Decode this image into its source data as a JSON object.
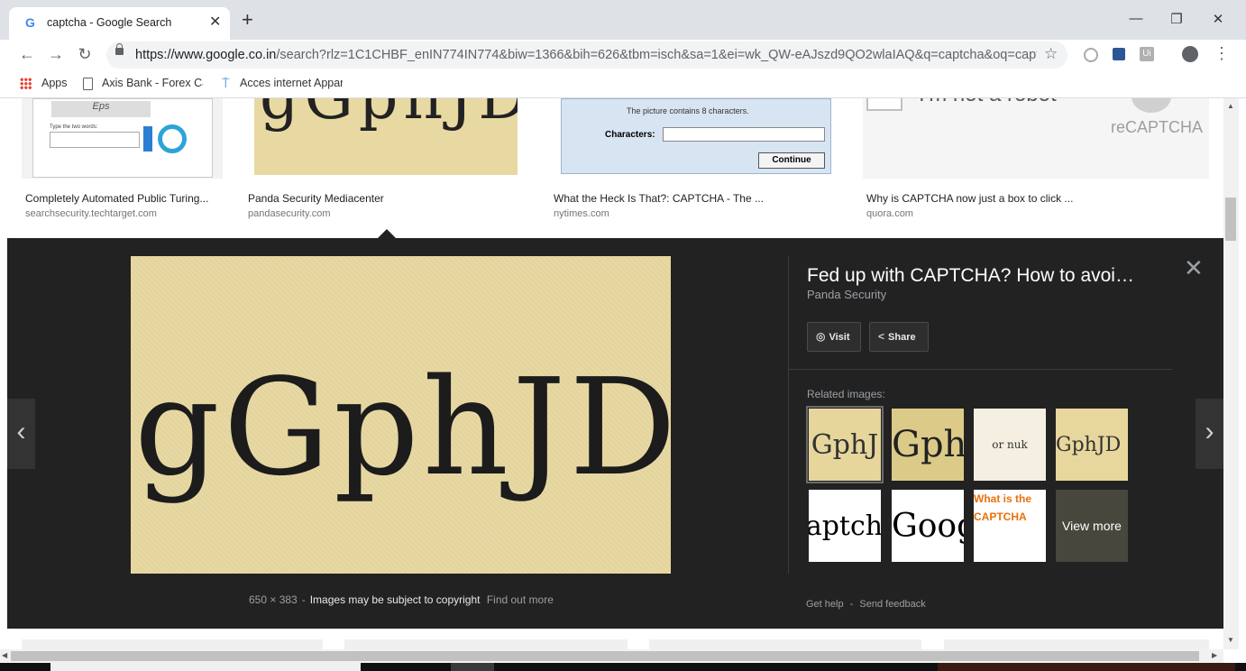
{
  "tab": {
    "favicon": "G",
    "title": "captcha - Google Search",
    "close": "✕",
    "new_tab": "+"
  },
  "window": {
    "minimize": "—",
    "restore": "❐",
    "close": "✕"
  },
  "nav": {
    "back": "←",
    "forward": "→",
    "reload": "↻"
  },
  "address": {
    "host": "https://www.google.co.in",
    "path": "/search?rlz=1C1CHBF_enIN774IN774&biw=1366&bih=626&tbm=isch&sa=1&ei=wk_QW-eAJszd9QO2wlaIAQ&q=captcha&oq=captc..."
  },
  "bookmarks": [
    {
      "label": "Apps",
      "icon": "apps-grid-icon"
    },
    {
      "label": "Axis Bank - Forex Car",
      "icon": "page-icon"
    },
    {
      "label": "Acces internet Appar",
      "icon": "antenna-icon"
    }
  ],
  "results": [
    {
      "title": "Completely Automated Public Turing...",
      "source": "searchsecurity.techtarget.com",
      "thumb_text": "Type the two words:"
    },
    {
      "title": "Panda Security Mediacenter",
      "source": "pandasecurity.com",
      "thumb_text": "gGphJD"
    },
    {
      "title": "What the Heck Is That?: CAPTCHA - The ...",
      "source": "nytimes.com",
      "thumb_text": "The picture contains 8 characters.",
      "field_label": "Characters:",
      "button": "Continue"
    },
    {
      "title": "Why is CAPTCHA now just a box to click ...",
      "source": "quora.com",
      "thumb_text": "I'm not a robot",
      "brand": "reCAPTCHA"
    }
  ],
  "preview": {
    "image_text": "gGphJD",
    "dimensions": "650 × 383",
    "copyright": "Images may be subject to copyright",
    "find_out_more": "Find out more",
    "title": "Fed up with CAPTCHA? How to avoi…",
    "source": "Panda Security",
    "visit": "Visit",
    "share": "Share",
    "related_label": "Related images:",
    "related": [
      {
        "text": "GphJ",
        "bg": "#e6d69c"
      },
      {
        "text": "Gph",
        "bg": "#dccb88"
      },
      {
        "text": "or nuk",
        "bg": "#f4efe0"
      },
      {
        "text": "GphJD",
        "bg": "#e8d79d"
      },
      {
        "text": "captcha",
        "bg": "#ffffff"
      },
      {
        "text": "Google",
        "bg": "#ffffff"
      },
      {
        "text": "What is the CAPTCHA",
        "bg": "#ffffff"
      },
      {
        "text": "View more",
        "bg": "#555555"
      }
    ],
    "get_help": "Get help",
    "send_feedback": "Send feedback",
    "prev": "‹",
    "next": "›",
    "close": "✕"
  },
  "colors": {
    "panel": "#222222",
    "accent": "#1a73e8"
  }
}
